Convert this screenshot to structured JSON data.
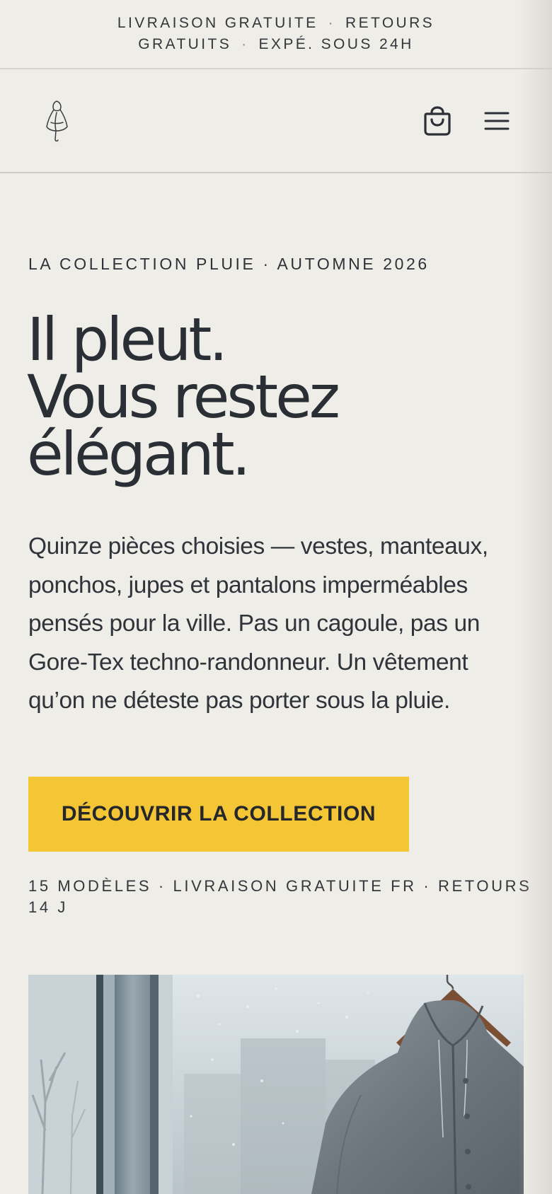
{
  "announcement": {
    "line1_a": "LIVRAISON GRATUITE",
    "line1_b": "RETOURS",
    "line2_a": "GRATUITS",
    "line2_b": "EXPÉ. SOUS 24H",
    "separator": "·"
  },
  "header": {
    "logo_icon": "raincoat-figure-logo",
    "cart_icon": "shopping-bag-icon",
    "menu_icon": "hamburger-menu-icon"
  },
  "hero": {
    "eyebrow": "LA COLLECTION PLUIE · AUTOMNE 2026",
    "headline": [
      "Il pleut.",
      "Vous restez",
      "élégant."
    ],
    "lede": "Quinze pièces choisies — vestes, manteaux, ponchos, jupes et pantalons imperméables pensés pour la ville. Pas un cagoule, pas un Gore-Tex techno-randonneur. Un vêtement qu’on ne déteste pas porter sous la pluie.",
    "cta_label": "DÉCOUVRIR LA COLLECTION",
    "meta": "15 MODÈLES · LIVRAISON GRATUITE FR · RETOURS 14 J"
  },
  "colors": {
    "background": "#efede8",
    "text": "#2b2f36",
    "accent": "#f4c535"
  }
}
